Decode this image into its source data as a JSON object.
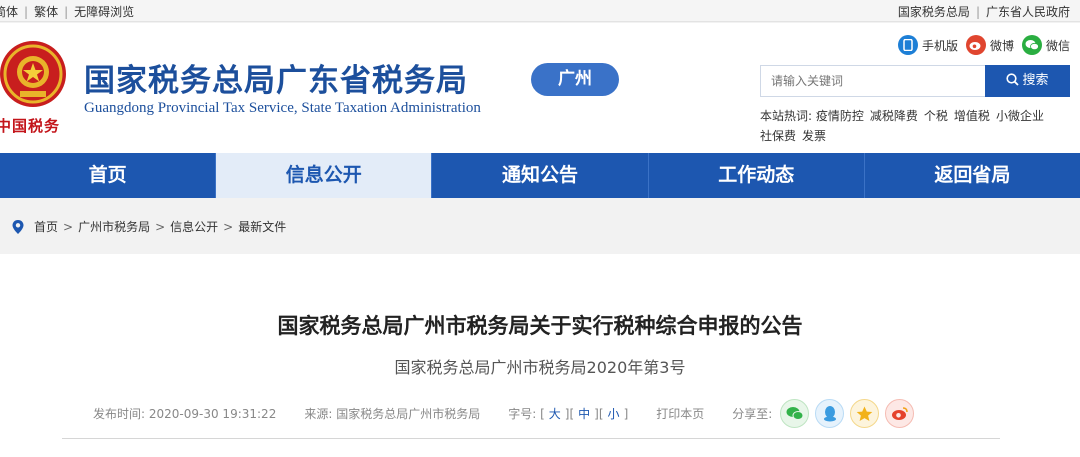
{
  "topbar": {
    "left": [
      "简体",
      "繁体",
      "无障碍浏览"
    ],
    "right": [
      "国家税务总局",
      "广东省人民政府"
    ]
  },
  "header": {
    "emblem_text": "中国税务",
    "title": "国家税务总局广东省税务局",
    "subtitle": "Guangdong Provincial Tax Service, State Taxation Administration",
    "city_badge": "广州",
    "social": [
      {
        "label": "手机版",
        "icon": "mobile-icon",
        "color": "#1d7fd6"
      },
      {
        "label": "微博",
        "icon": "weibo-icon",
        "color": "#e0452f"
      },
      {
        "label": "微信",
        "icon": "wechat-icon",
        "color": "#2aae41"
      }
    ],
    "search": {
      "placeholder": "请输入关键词",
      "button": "搜索"
    },
    "hotwords_label": "本站热词:",
    "hotwords": [
      "疫情防控",
      "减税降费",
      "个税",
      "增值税",
      "小微企业",
      "社保费",
      "发票"
    ]
  },
  "nav": {
    "tabs": [
      "首页",
      "信息公开",
      "通知公告",
      "工作动态",
      "返回省局"
    ],
    "active_index": 1
  },
  "breadcrumb": [
    "首页",
    "广州市税务局",
    "信息公开",
    "最新文件"
  ],
  "article": {
    "title": "国家税务总局广州市税务局关于实行税种综合申报的公告",
    "doc_number": "国家税务总局广州市税务局2020年第3号",
    "publish_label": "发布时间:",
    "publish_time": "2020-09-30 19:31:22",
    "source_label": "来源:",
    "source": "国家税务总局广州市税务局",
    "font_label": "字号:",
    "font_sizes": [
      "大",
      "中",
      "小"
    ],
    "print": "打印本页",
    "share_label": "分享至:",
    "share": [
      {
        "icon": "wechat-icon",
        "color": "#33b24a"
      },
      {
        "icon": "qq-icon",
        "color": "#3a9be0"
      },
      {
        "icon": "qzone-icon",
        "color": "#f2b21a"
      },
      {
        "icon": "weibo-icon",
        "color": "#e5422c"
      }
    ]
  }
}
